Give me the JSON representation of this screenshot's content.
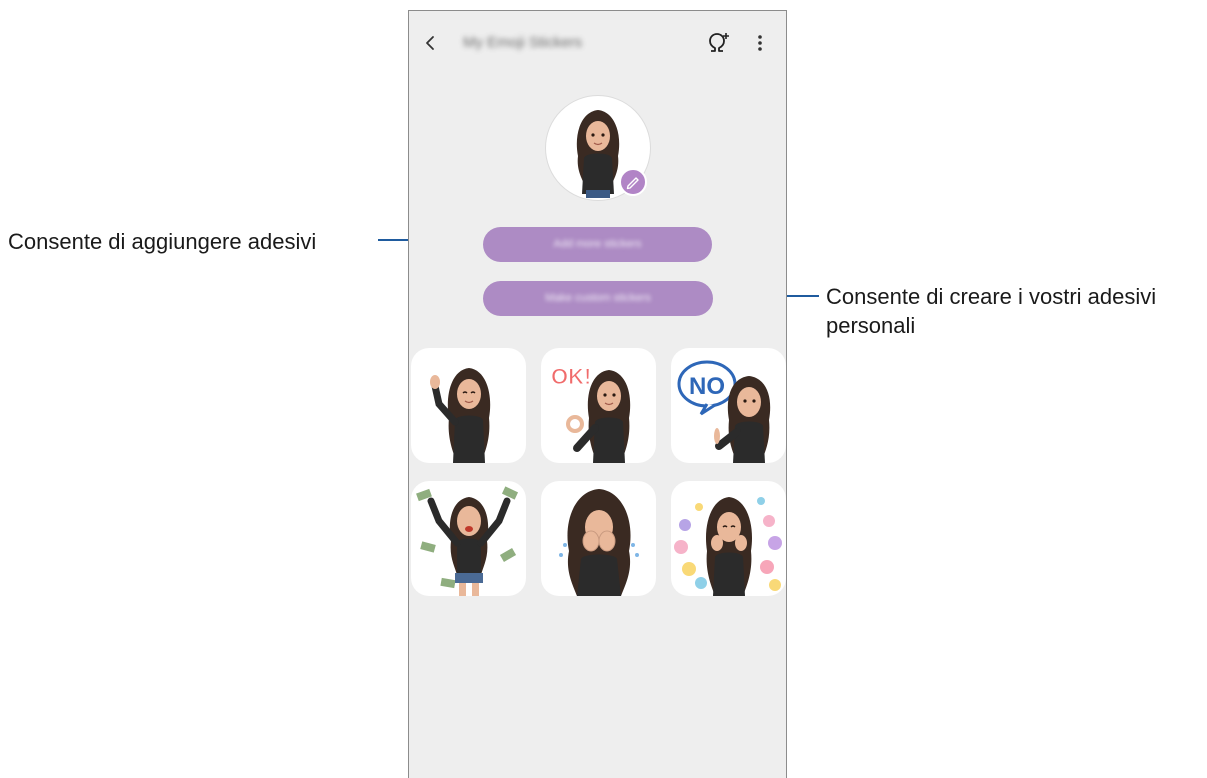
{
  "app": {
    "title": "My Emoji Stickers"
  },
  "toolbar": {
    "back_icon": "chevron-left-icon",
    "add_avatar_icon": "avatar-add-icon",
    "more_icon": "more-vertical-icon"
  },
  "profile": {
    "avatar_icon": "avatar-emoji",
    "edit_icon": "pencil-icon"
  },
  "buttons": {
    "add_stickers_label": "Add more stickers",
    "make_custom_label": "Make custom stickers"
  },
  "stickers": [
    {
      "name": "wave",
      "badge": ""
    },
    {
      "name": "ok",
      "badge": "OK!"
    },
    {
      "name": "no",
      "badge": "NO"
    },
    {
      "name": "money",
      "badge": ""
    },
    {
      "name": "cry",
      "badge": ""
    },
    {
      "name": "love",
      "badge": ""
    }
  ],
  "annotations": {
    "add_stickers": "Consente di aggiungere adesivi",
    "custom_stickers": "Consente di creare i vostri adesivi personali"
  },
  "colors": {
    "accent": "#ad8bc4",
    "callout_line": "#1f5b9e",
    "screen_bg": "#eeeeee"
  }
}
